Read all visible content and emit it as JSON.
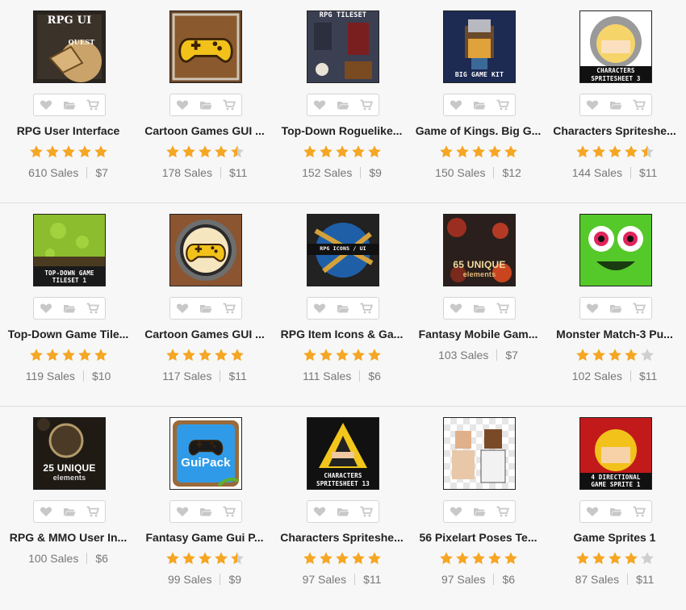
{
  "colors": {
    "star": "#f5a623",
    "star_empty": "#cfcfcf",
    "icon": "#c8c8c8"
  },
  "rows": [
    {
      "items": [
        {
          "name": "RPG User Interface",
          "sales": "610 Sales",
          "price": "$7",
          "rating": 5,
          "thumb_text": [
            "RPG UI",
            "QUEST"
          ],
          "thumb": "rpgui"
        },
        {
          "name": "Cartoon Games GUI ...",
          "sales": "178 Sales",
          "price": "$11",
          "rating": 4.5,
          "thumb_text": [],
          "thumb": "gamepad-brown"
        },
        {
          "name": "Top-Down Roguelike...",
          "sales": "152 Sales",
          "price": "$9",
          "rating": 5,
          "thumb_text": [
            "RPG TILESET"
          ],
          "thumb": "rogue"
        },
        {
          "name": "Game of Kings. Big G...",
          "sales": "150 Sales",
          "price": "$12",
          "rating": 5,
          "thumb_text": [
            "BIG GAME KIT"
          ],
          "thumb": "viking"
        },
        {
          "name": "Characters Spriteshe...",
          "sales": "144 Sales",
          "price": "$11",
          "rating": 4.5,
          "thumb_text": [
            "CHARACTERS",
            "SPRITESHEET 3"
          ],
          "thumb": "knight"
        }
      ]
    },
    {
      "items": [
        {
          "name": "Top-Down Game Tile...",
          "sales": "119 Sales",
          "price": "$10",
          "rating": 5,
          "thumb_text": [
            "TOP-DOWN GAME",
            "TILESET 1"
          ],
          "thumb": "grass"
        },
        {
          "name": "Cartoon Games GUI ...",
          "sales": "117 Sales",
          "price": "$11",
          "rating": 5,
          "thumb_text": [],
          "thumb": "gamepad-round"
        },
        {
          "name": "RPG Item Icons & Ga...",
          "sales": "111 Sales",
          "price": "$6",
          "rating": 5,
          "thumb_text": [
            "RPG ICONS / UI"
          ],
          "thumb": "icons"
        },
        {
          "name": "Fantasy Mobile Gam...",
          "sales": "103 Sales",
          "price": "$7",
          "rating": 0,
          "thumb_text": [
            "65 UNIQUE",
            "elements"
          ],
          "thumb": "unique65"
        },
        {
          "name": "Monster Match-3 Pu...",
          "sales": "102 Sales",
          "price": "$11",
          "rating": 4,
          "thumb_text": [],
          "thumb": "monster"
        }
      ]
    },
    {
      "items": [
        {
          "name": "RPG & MMO User In...",
          "sales": "100 Sales",
          "price": "$6",
          "rating": 0,
          "thumb_text": [
            "25 UNIQUE",
            "elements"
          ],
          "thumb": "unique25"
        },
        {
          "name": "Fantasy Game Gui P...",
          "sales": "99 Sales",
          "price": "$9",
          "rating": 4.5,
          "thumb_text": [
            "GuiPack"
          ],
          "thumb": "guipack"
        },
        {
          "name": "Characters Spriteshe...",
          "sales": "97 Sales",
          "price": "$11",
          "rating": 5,
          "thumb_text": [
            "CHARACTERS",
            "SPRITESHEET 13"
          ],
          "thumb": "hood"
        },
        {
          "name": "56 Pixelart Poses Te...",
          "sales": "97 Sales",
          "price": "$6",
          "rating": 5,
          "thumb_text": [],
          "thumb": "pixel"
        },
        {
          "name": "Game Sprites 1",
          "sales": "87 Sales",
          "price": "$11",
          "rating": 4,
          "thumb_text": [
            "4 DIRECTIONAL",
            "GAME SPRITE 1"
          ],
          "thumb": "sprite"
        }
      ]
    }
  ]
}
